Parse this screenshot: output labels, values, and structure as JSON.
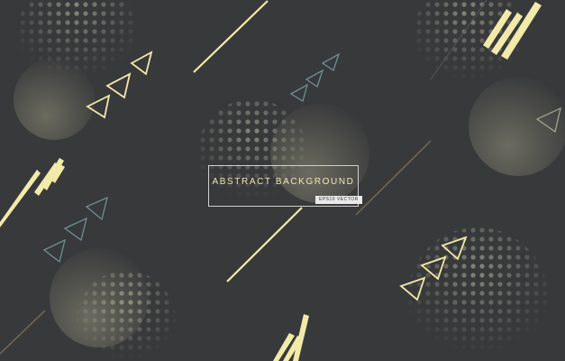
{
  "banner": {
    "title": "ABSTRACT  BACKGROUND",
    "badge": "EPS10 VECTOR"
  },
  "colors": {
    "background": "#38393b",
    "accent_yellow": "#f2eaa8",
    "outline_teal": "#6f8f93",
    "dots_light": "#c8c6b0",
    "brown_line": "#7a6a5a"
  }
}
